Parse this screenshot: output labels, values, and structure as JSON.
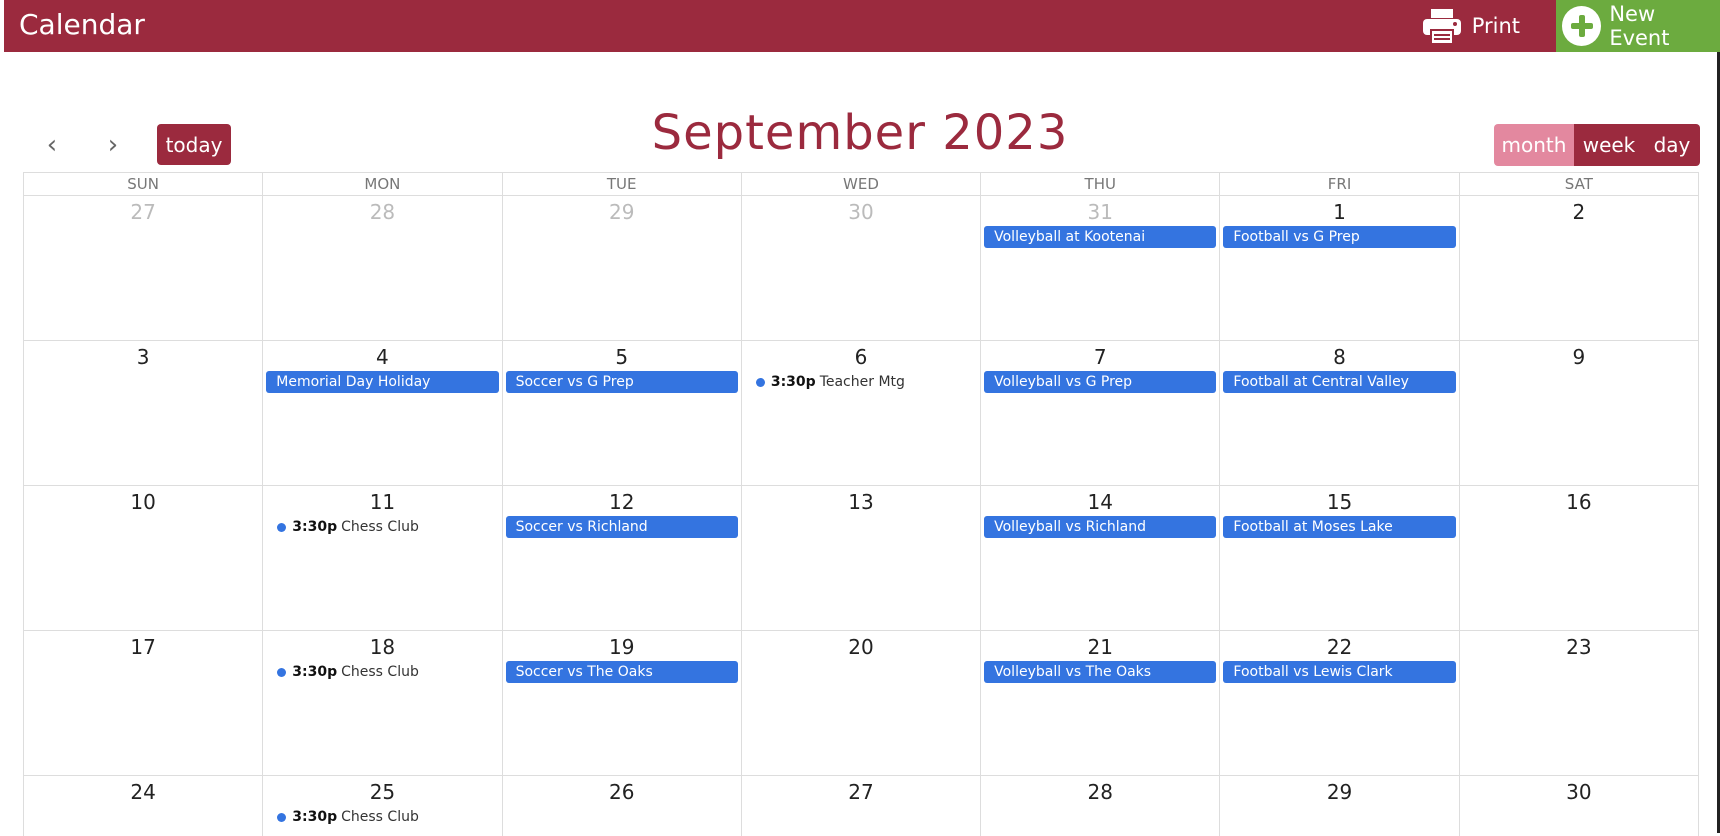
{
  "header": {
    "title": "Calendar",
    "print_label": "Print",
    "new_event_label": "New Event"
  },
  "toolbar": {
    "prev": "‹",
    "next": "›",
    "today_label": "today",
    "title": "September 2023",
    "views": [
      "month",
      "week",
      "day"
    ],
    "active_view": "month"
  },
  "weekdays": [
    "SUN",
    "MON",
    "TUE",
    "WED",
    "THU",
    "FRI",
    "SAT"
  ],
  "colors": {
    "brand": "#9b2a3e",
    "event": "#3474e0",
    "new_event": "#6cab3f",
    "active_view": "#e3889f"
  },
  "weeks": [
    [
      {
        "num": "27",
        "other": true,
        "events": []
      },
      {
        "num": "28",
        "other": true,
        "events": []
      },
      {
        "num": "29",
        "other": true,
        "events": []
      },
      {
        "num": "30",
        "other": true,
        "events": []
      },
      {
        "num": "31",
        "other": true,
        "events": [
          {
            "type": "bar",
            "title": "Volleyball at Kootenai"
          }
        ]
      },
      {
        "num": "1",
        "events": [
          {
            "type": "bar",
            "title": "Football vs G Prep"
          }
        ]
      },
      {
        "num": "2",
        "events": []
      }
    ],
    [
      {
        "num": "3",
        "events": []
      },
      {
        "num": "4",
        "events": [
          {
            "type": "bar",
            "title": "Memorial Day Holiday"
          }
        ]
      },
      {
        "num": "5",
        "events": [
          {
            "type": "bar",
            "title": "Soccer vs G Prep"
          }
        ]
      },
      {
        "num": "6",
        "events": [
          {
            "type": "dot",
            "time": "3:30p",
            "title": "Teacher Mtg"
          }
        ]
      },
      {
        "num": "7",
        "events": [
          {
            "type": "bar",
            "title": "Volleyball vs G Prep"
          }
        ]
      },
      {
        "num": "8",
        "events": [
          {
            "type": "bar",
            "title": "Football at Central Valley"
          }
        ]
      },
      {
        "num": "9",
        "events": []
      }
    ],
    [
      {
        "num": "10",
        "events": []
      },
      {
        "num": "11",
        "events": [
          {
            "type": "dot",
            "time": "3:30p",
            "title": "Chess Club"
          }
        ]
      },
      {
        "num": "12",
        "events": [
          {
            "type": "bar",
            "title": "Soccer vs Richland"
          }
        ]
      },
      {
        "num": "13",
        "events": []
      },
      {
        "num": "14",
        "events": [
          {
            "type": "bar",
            "title": "Volleyball vs Richland"
          }
        ]
      },
      {
        "num": "15",
        "events": [
          {
            "type": "bar",
            "title": "Football at Moses Lake"
          }
        ]
      },
      {
        "num": "16",
        "events": []
      }
    ],
    [
      {
        "num": "17",
        "events": []
      },
      {
        "num": "18",
        "events": [
          {
            "type": "dot",
            "time": "3:30p",
            "title": "Chess Club"
          }
        ]
      },
      {
        "num": "19",
        "events": [
          {
            "type": "bar",
            "title": "Soccer vs The Oaks"
          }
        ]
      },
      {
        "num": "20",
        "events": []
      },
      {
        "num": "21",
        "events": [
          {
            "type": "bar",
            "title": "Volleyball vs The Oaks"
          }
        ]
      },
      {
        "num": "22",
        "events": [
          {
            "type": "bar",
            "title": "Football vs Lewis Clark"
          }
        ]
      },
      {
        "num": "23",
        "events": []
      }
    ],
    [
      {
        "num": "24",
        "events": []
      },
      {
        "num": "25",
        "events": [
          {
            "type": "dot",
            "time": "3:30p",
            "title": "Chess Club"
          }
        ]
      },
      {
        "num": "26",
        "events": []
      },
      {
        "num": "27",
        "events": []
      },
      {
        "num": "28",
        "events": []
      },
      {
        "num": "29",
        "events": []
      },
      {
        "num": "30",
        "events": []
      }
    ]
  ]
}
